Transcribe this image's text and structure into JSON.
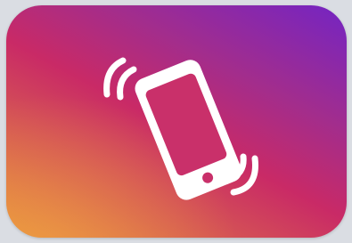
{
  "icon": {
    "name": "phone-vibrate-icon",
    "glyph_color": "#ffffff"
  },
  "colors": {
    "gradient_start": "#e8963a",
    "gradient_mid": "#c92a66",
    "gradient_end": "#7424c3",
    "frame_background": "#dadde3"
  }
}
